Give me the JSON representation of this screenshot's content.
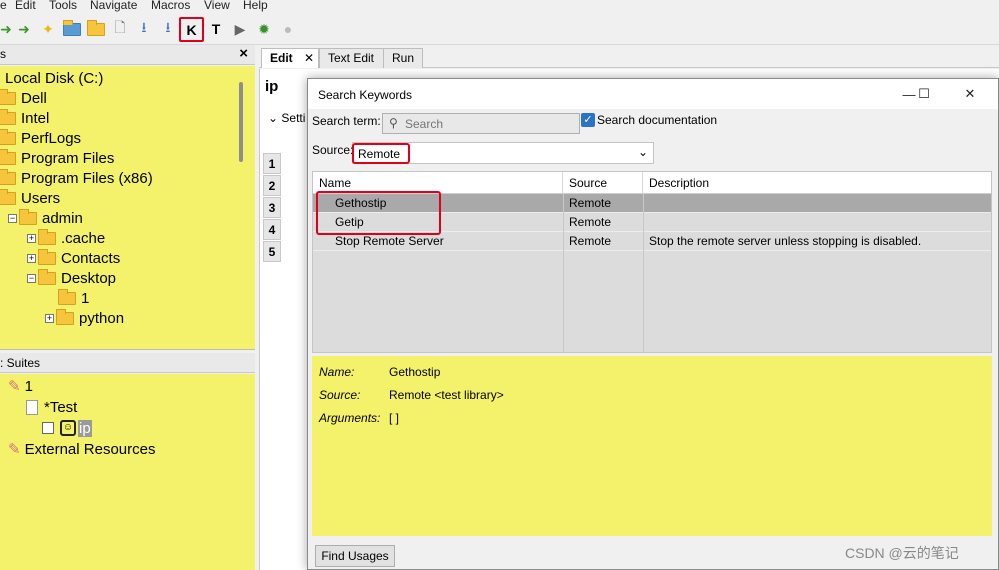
{
  "menu": [
    "e",
    "Edit",
    "Tools",
    "Navigate",
    "Macros",
    "View",
    "Help"
  ],
  "toolbar": {
    "keyword_search_label": "K",
    "test_search_label": "T"
  },
  "file_explorer": {
    "header_close": "×",
    "items": [
      {
        "label": "Local Disk (C:)"
      },
      {
        "label": "Dell"
      },
      {
        "label": "Intel"
      },
      {
        "label": "PerfLogs"
      },
      {
        "label": "Program Files"
      },
      {
        "label": "Program Files (x86)"
      },
      {
        "label": "Users"
      },
      {
        "label": "admin"
      },
      {
        "label": ".cache"
      },
      {
        "label": "Contacts"
      },
      {
        "label": "Desktop"
      },
      {
        "label": "1"
      },
      {
        "label": "python"
      }
    ]
  },
  "test_suites": {
    "header": ": Suites",
    "items": [
      {
        "label": "1"
      },
      {
        "label": "*Test"
      },
      {
        "label": "ip"
      },
      {
        "label": "External Resources"
      }
    ]
  },
  "editor": {
    "tabs": [
      "Edit",
      "Text Edit",
      "Run"
    ],
    "title": "ip",
    "settings_label": "Setti",
    "row_numbers": [
      "1",
      "2",
      "3",
      "4",
      "5"
    ]
  },
  "dialog": {
    "title": "Search Keywords",
    "search_term_label": "Search term:",
    "search_placeholder": "Search",
    "search_doc_label": "Search documentation",
    "search_doc_checked": true,
    "source_label": "Source:",
    "source_value": "Remote",
    "columns": [
      "Name",
      "Source",
      "Description"
    ],
    "rows": [
      {
        "name": "Gethostip",
        "source": "Remote",
        "description": ""
      },
      {
        "name": "Getip",
        "source": "Remote",
        "description": ""
      },
      {
        "name": "Stop Remote Server",
        "source": "Remote",
        "description": "Stop the remote server unless stopping is disabled."
      }
    ],
    "details": {
      "name_label": "Name:",
      "name_value": "Gethostip",
      "source_label": "Source:",
      "source_value": "Remote <test library>",
      "arguments_label": "Arguments:",
      "arguments_value": "[ ]"
    },
    "find_usages_label": "Find Usages"
  },
  "watermark": "CSDN @云的笔记",
  "colors": {
    "panel_yellow": "#f4f26a",
    "highlight_red": "#e0001b",
    "selected_row": "#a9a9a9"
  }
}
